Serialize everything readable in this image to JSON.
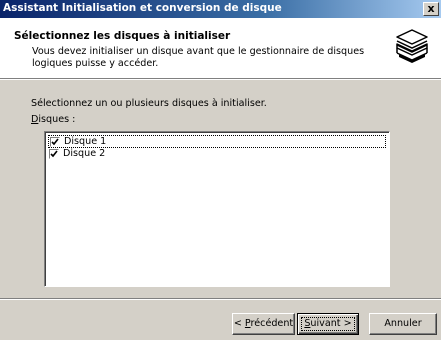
{
  "window": {
    "title": "Assistant Initialisation et conversion de disque",
    "close_label": "x"
  },
  "header": {
    "title": "Sélectionnez les disques à initialiser",
    "subtitle": "Vous devez initialiser un disque avant que le gestionnaire de disques logiques puisse y accéder.",
    "icon": "disk-stack-icon"
  },
  "body": {
    "instruction": "Sélectionnez un ou plusieurs disques à initialiser.",
    "disks_label_accel": "D",
    "disks_label_rest": "isques :",
    "disks": [
      {
        "label": "Disque 1",
        "checked": true
      },
      {
        "label": "Disque 2",
        "checked": true
      }
    ]
  },
  "buttons": {
    "back_prefix": "< ",
    "back_accel": "P",
    "back_rest": "récédent",
    "next_accel": "S",
    "next_rest": "uivant >",
    "cancel": "Annuler"
  }
}
